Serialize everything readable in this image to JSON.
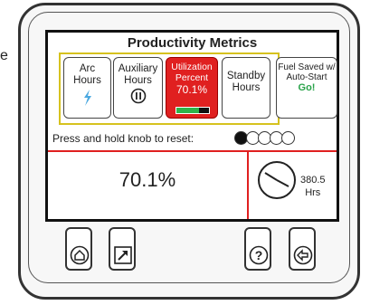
{
  "edge_letter": "e",
  "screen": {
    "title": "Productivity Metrics",
    "tiles": [
      {
        "id": "arc",
        "label": "Arc Hours",
        "icon": "lightning-arc-icon"
      },
      {
        "id": "aux",
        "label": "Auxiliary Hours",
        "icon": "auxiliary-power-icon"
      },
      {
        "id": "util",
        "label": "Utilization Percent",
        "value": "70.1%",
        "progress": 0.7,
        "colors": {
          "bg": "#e02020",
          "bar": "#2fb34a"
        }
      },
      {
        "id": "standby",
        "label": "Standby Hours"
      },
      {
        "id": "fuel",
        "label": "Fuel Saved w/ Auto-Start",
        "status": "Go!",
        "status_color": "#2aa34a"
      }
    ],
    "reset_hint": "Press and hold knob to reset:",
    "pager": {
      "count": 5,
      "active": 0
    },
    "readout": {
      "value": "70.1%"
    },
    "hours": {
      "value": "380.5",
      "unit": "Hrs",
      "icon": "clock-icon"
    }
  },
  "buttons": [
    {
      "id": "home",
      "icon": "home-icon"
    },
    {
      "id": "expand",
      "icon": "expand-arrow-icon"
    },
    {
      "id": "help",
      "icon": "help-icon"
    },
    {
      "id": "back",
      "icon": "back-arrow-icon"
    }
  ]
}
